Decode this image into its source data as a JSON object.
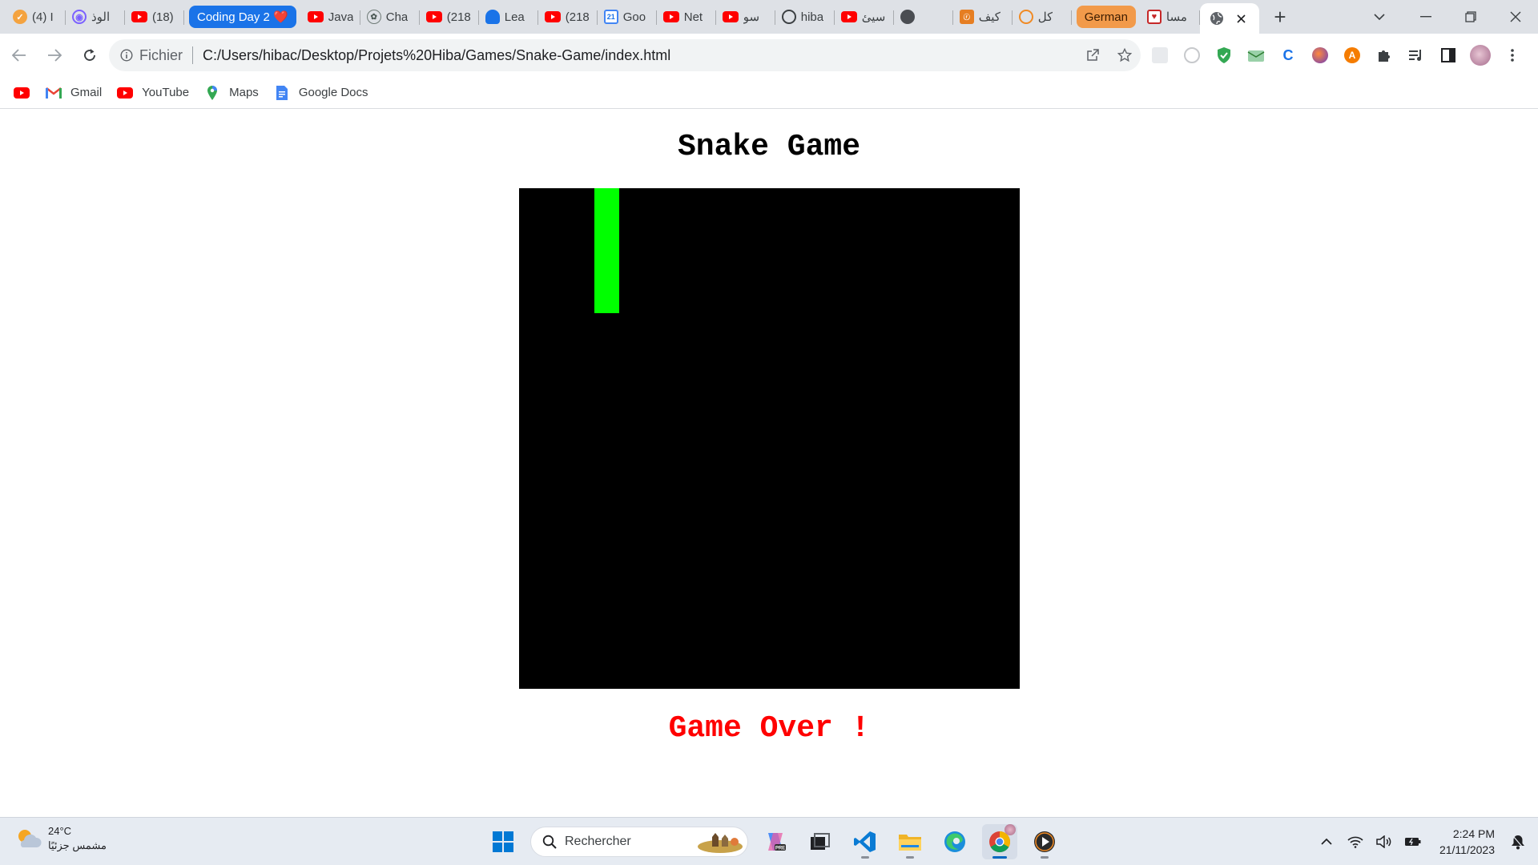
{
  "browser": {
    "tabs": [
      {
        "title": "(4) I",
        "icon": "orange-check-icon"
      },
      {
        "title": "الوذ",
        "icon": "purple-audio-icon"
      },
      {
        "title": "(18)",
        "icon": "youtube-icon"
      },
      {
        "title": "Coding Day 2 ❤️",
        "icon": "",
        "group": "blue"
      },
      {
        "title": "Java",
        "icon": "youtube-icon"
      },
      {
        "title": "Cha",
        "icon": "chatgpt-icon"
      },
      {
        "title": "(218",
        "icon": "youtube-icon"
      },
      {
        "title": "Lea",
        "icon": "blue-person-icon"
      },
      {
        "title": "(218",
        "icon": "youtube-icon"
      },
      {
        "title": "Goo",
        "icon": "google-calendar-icon"
      },
      {
        "title": "Net",
        "icon": "youtube-icon"
      },
      {
        "title": "سو",
        "icon": "youtube-icon"
      },
      {
        "title": "hiba",
        "icon": "github-icon"
      },
      {
        "title": "سيئ",
        "icon": "youtube-icon"
      },
      {
        "title": "",
        "icon": "dark-circle-icon"
      },
      {
        "title": "كيف",
        "icon": "orange-square-icon"
      },
      {
        "title": "كل",
        "icon": "orange-circle-icon"
      },
      {
        "title": "German",
        "icon": "",
        "group": "orange"
      },
      {
        "title": "مسا",
        "icon": "red-heart-square-icon"
      },
      {
        "title": "",
        "icon": "globe-icon",
        "active": true
      }
    ],
    "address": {
      "scheme_label": "Fichier",
      "url": "C:/Users/hibac/Desktop/Projets%20Hiba/Games/Snake-Game/index.html"
    },
    "bookmarks": [
      {
        "label": "",
        "icon": "youtube-icon"
      },
      {
        "label": "Gmail",
        "icon": "gmail-icon"
      },
      {
        "label": "YouTube",
        "icon": "youtube-icon"
      },
      {
        "label": "Maps",
        "icon": "maps-pin-icon"
      },
      {
        "label": "Google Docs",
        "icon": "google-docs-icon"
      }
    ]
  },
  "game": {
    "title": "Snake Game",
    "message": "Game Over !",
    "colors": {
      "board": "#000000",
      "snake": "#00ff00",
      "message": "#ff0000"
    },
    "snake_cells": [
      [
        3,
        0
      ],
      [
        3,
        1
      ],
      [
        3,
        2
      ],
      [
        3,
        3
      ],
      [
        3,
        4
      ]
    ],
    "grid_size": 20
  },
  "taskbar": {
    "weather": {
      "temperature": "24°C",
      "condition": "مشمس جزئيًا"
    },
    "search_placeholder": "Rechercher",
    "apps": [
      "start-icon",
      "search",
      "copilot-icon",
      "task-view-icon",
      "vscode-icon",
      "file-explorer-icon",
      "edge-icon",
      "chrome-icon",
      "media-player-icon"
    ],
    "clock": {
      "time": "2:24 PM",
      "date": "21/11/2023"
    }
  }
}
